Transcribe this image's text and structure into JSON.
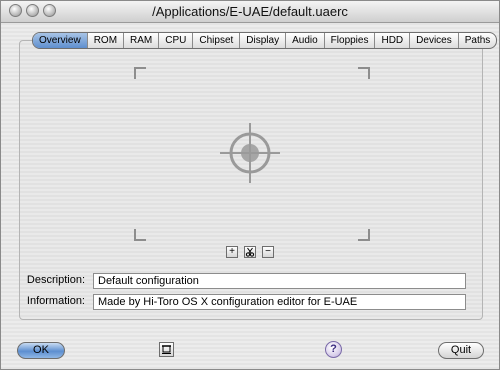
{
  "window": {
    "title": "/Applications/E-UAE/default.uaerc"
  },
  "tabs": [
    {
      "label": "Overview",
      "active": true
    },
    {
      "label": "ROM"
    },
    {
      "label": "RAM"
    },
    {
      "label": "CPU"
    },
    {
      "label": "Chipset"
    },
    {
      "label": "Display"
    },
    {
      "label": "Audio"
    },
    {
      "label": "Floppies"
    },
    {
      "label": "HDD"
    },
    {
      "label": "Devices"
    },
    {
      "label": "Paths"
    }
  ],
  "image_area": {
    "controls": {
      "add": "+",
      "remove": "−",
      "clear_icon": "scissors-icon"
    }
  },
  "form": {
    "description_label": "Description:",
    "description_value": "Default configuration",
    "information_label": "Information:",
    "information_value": "Made by Hi-Toro OS X configuration editor for E-UAE"
  },
  "footer": {
    "ok_label": "OK",
    "help_label": "?",
    "quit_label": "Quit"
  },
  "colors": {
    "accent": "#5f8fcf",
    "help": "#b3a5d4"
  }
}
